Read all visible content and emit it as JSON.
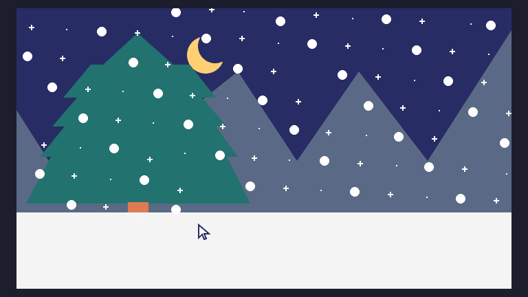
{
  "scene": {
    "colors": {
      "frame": "#1c1e2e",
      "sky": "#272c64",
      "mountains": "#5a6a86",
      "tree": "#22726f",
      "trunk": "#e07a55",
      "moon": "#ffcf74",
      "ground": "#f4f4f4",
      "snow": "#ffffff",
      "cursor": "#272c64"
    },
    "elements": {
      "moon": "crescent-moon",
      "tree": "pine-tree",
      "cursor": "arrow-cursor-icon"
    }
  }
}
